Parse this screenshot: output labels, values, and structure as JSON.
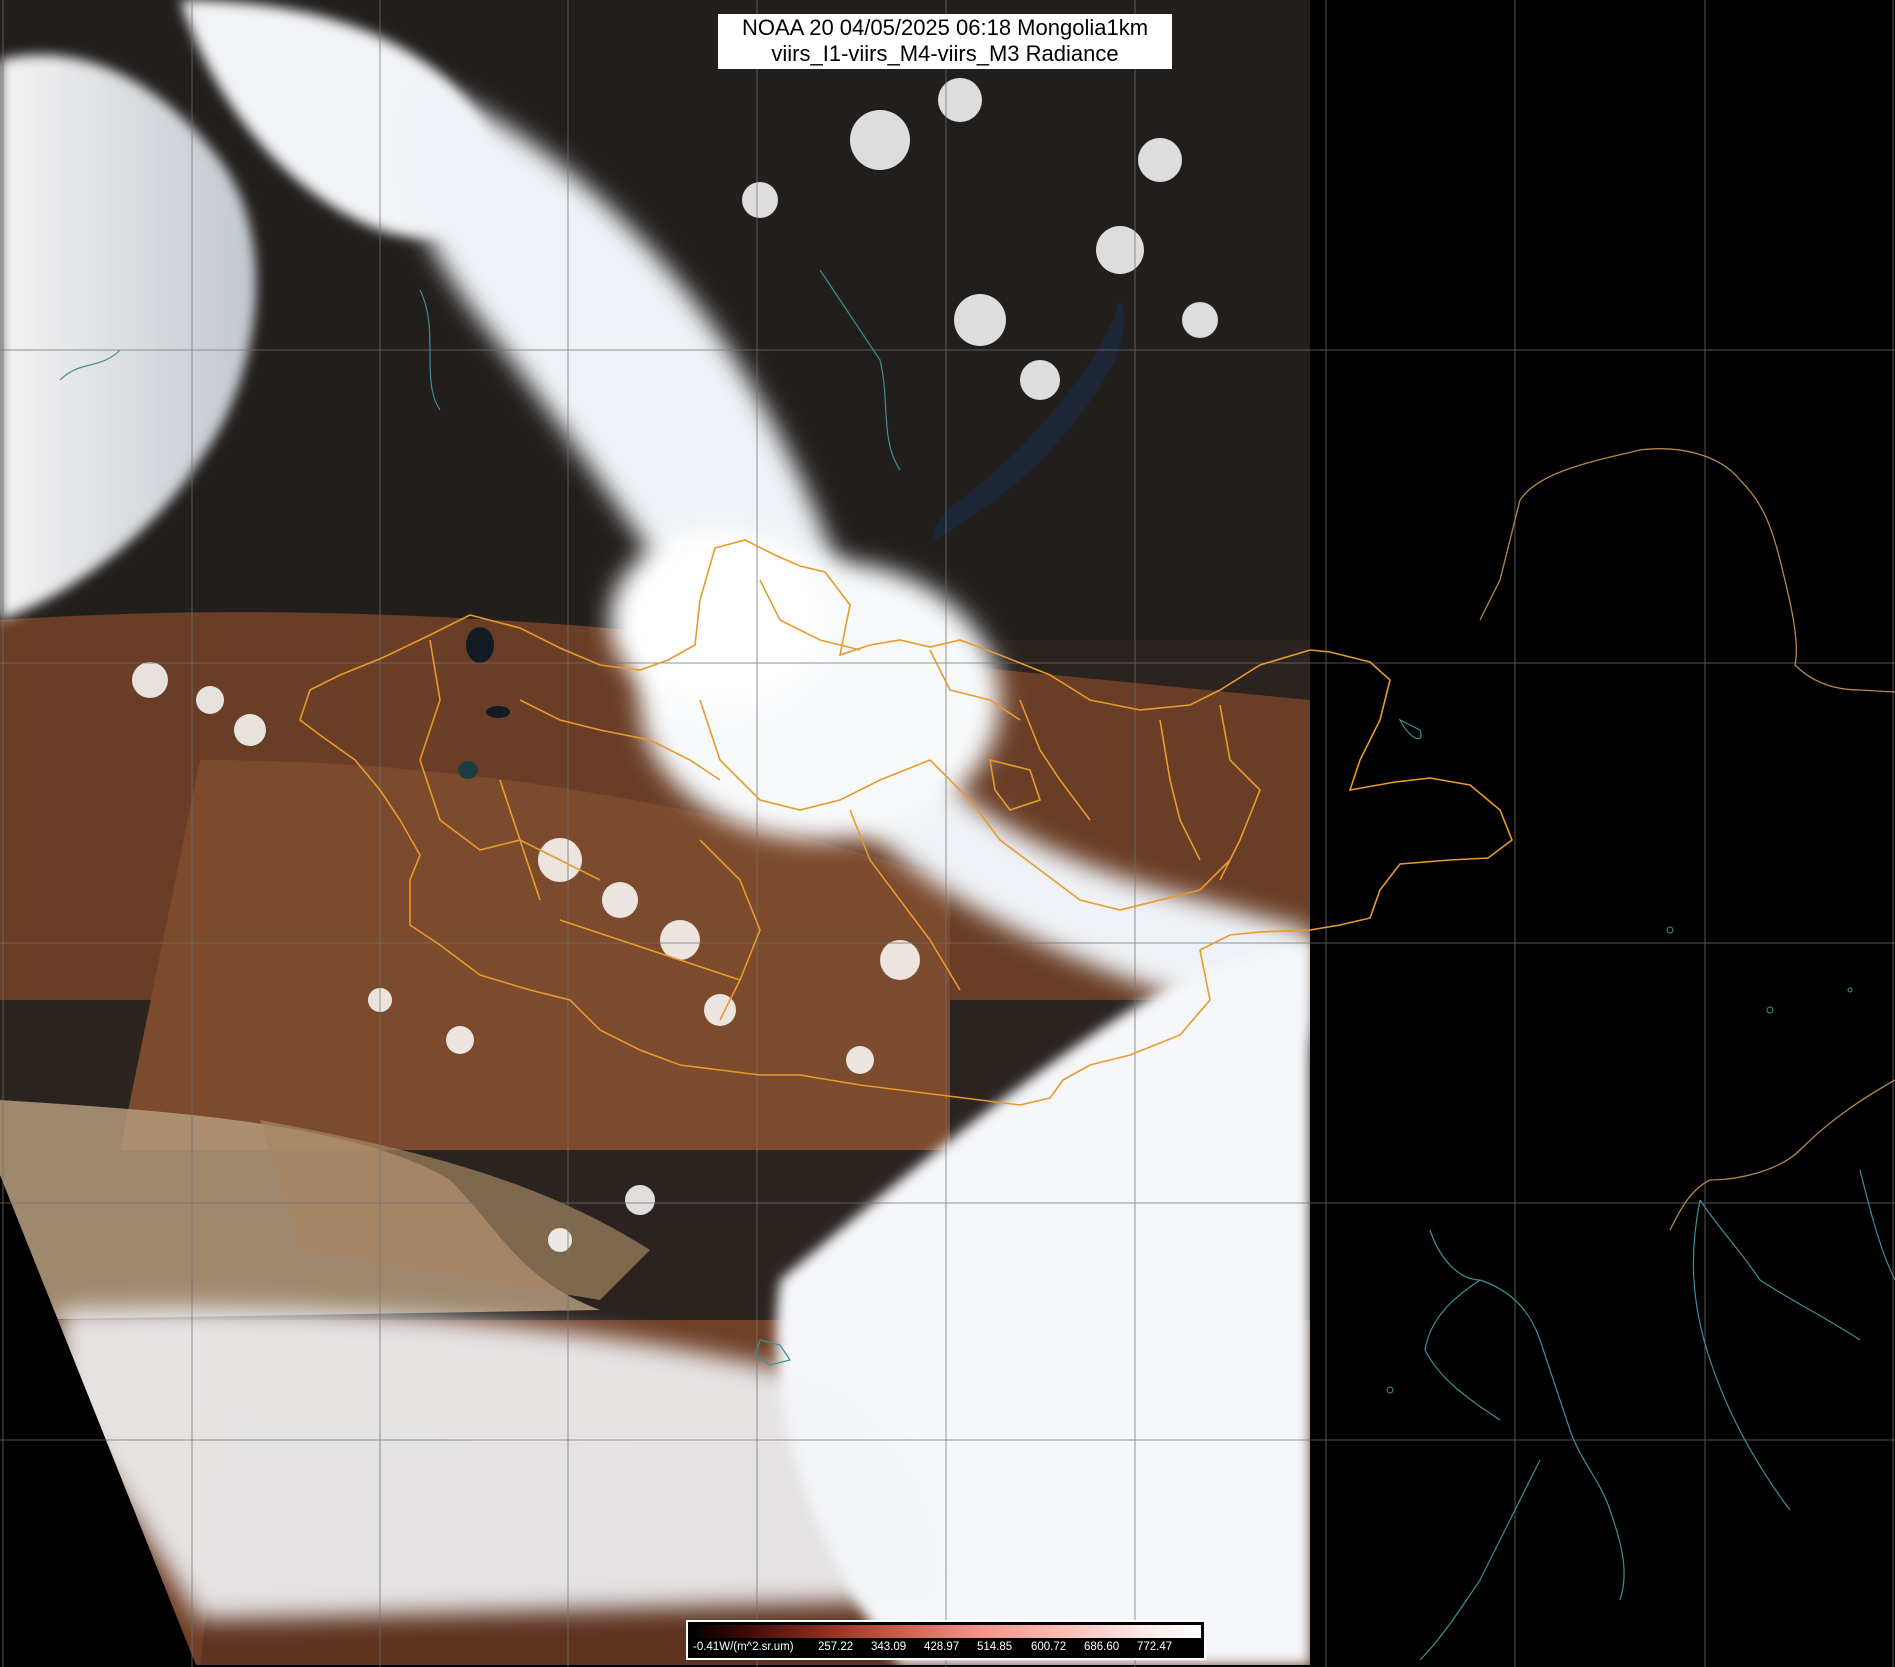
{
  "title": {
    "line1": "NOAA 20 04/05/2025 06:18 Mongolia1km",
    "line2": "viirs_I1-viirs_M4-viirs_M3 Radiance"
  },
  "colorbar": {
    "labels": [
      "-0.41W/(m^2.sr.um)",
      "257.22",
      "343.09",
      "428.97",
      "514.85",
      "600.72",
      "686.60",
      "772.47"
    ]
  },
  "colors": {
    "background": "#000000",
    "graticule": "#707070",
    "mongolia_borders": "#e89a2a",
    "china_border": "#b8864a",
    "coastline": "#3e8f96",
    "cloud": "#f5f7fa",
    "land_brown": "#7a4a2e",
    "dust": "#b59a7d"
  }
}
